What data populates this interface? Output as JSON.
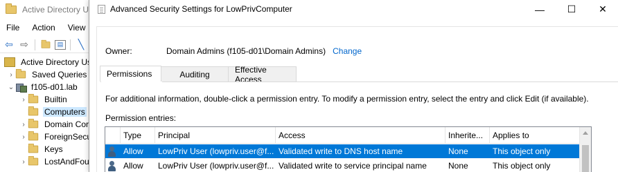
{
  "aduc": {
    "title": "Active Directory Us",
    "menu": [
      "File",
      "Action",
      "View"
    ],
    "toolbar_icons": [
      "back-arrow-icon",
      "forward-arrow-icon",
      "folder-up-icon",
      "console-tree-icon",
      "help-icon"
    ],
    "tree": [
      {
        "label": "Active Directory Us",
        "level": 0,
        "icon": "ad-icon",
        "arrow": ""
      },
      {
        "label": "Saved Queries",
        "level": 1,
        "icon": "folder-icon",
        "arrow": ">"
      },
      {
        "label": "f105-d01.lab",
        "level": 1,
        "icon": "domain-icon",
        "arrow": "v"
      },
      {
        "label": "Builtin",
        "level": 2,
        "icon": "folder-icon",
        "arrow": ">"
      },
      {
        "label": "Computers",
        "level": 2,
        "icon": "folder-icon",
        "arrow": "",
        "selected": true
      },
      {
        "label": "Domain Cor",
        "level": 2,
        "icon": "folder-icon",
        "arrow": ">"
      },
      {
        "label": "ForeignSecu",
        "level": 2,
        "icon": "folder-icon",
        "arrow": ">"
      },
      {
        "label": "Keys",
        "level": 2,
        "icon": "folder-icon",
        "arrow": ""
      },
      {
        "label": "LostAndFou",
        "level": 2,
        "icon": "folder-icon",
        "arrow": ">"
      }
    ]
  },
  "dialog": {
    "title": "Advanced Security Settings for LowPrivComputer",
    "minimize_glyph": "—",
    "maximize_glyph": "☐",
    "close_glyph": "✕",
    "owner_label": "Owner:",
    "owner_value": "Domain Admins (f105-d01\\Domain Admins)",
    "change_link": "Change",
    "tabs": [
      "Permissions",
      "Auditing",
      "Effective Access"
    ],
    "active_tab": "Permissions",
    "info_text": "For additional information, double-click a permission entry. To modify a permission entry, select the entry and click Edit (if available).",
    "entries_label": "Permission entries:",
    "columns": [
      "Type",
      "Principal",
      "Access",
      "Inherite...",
      "Applies to"
    ],
    "rows": [
      {
        "type": "Allow",
        "principal": "LowPriv User (lowpriv.user@f...",
        "access": "Validated write to DNS host name",
        "inherited": "None",
        "applies_to": "This object only",
        "selected": true
      },
      {
        "type": "Allow",
        "principal": "LowPriv User (lowpriv.user@f...",
        "access": "Validated write to service principal name",
        "inherited": "None",
        "applies_to": "This object only",
        "selected": false
      }
    ]
  }
}
